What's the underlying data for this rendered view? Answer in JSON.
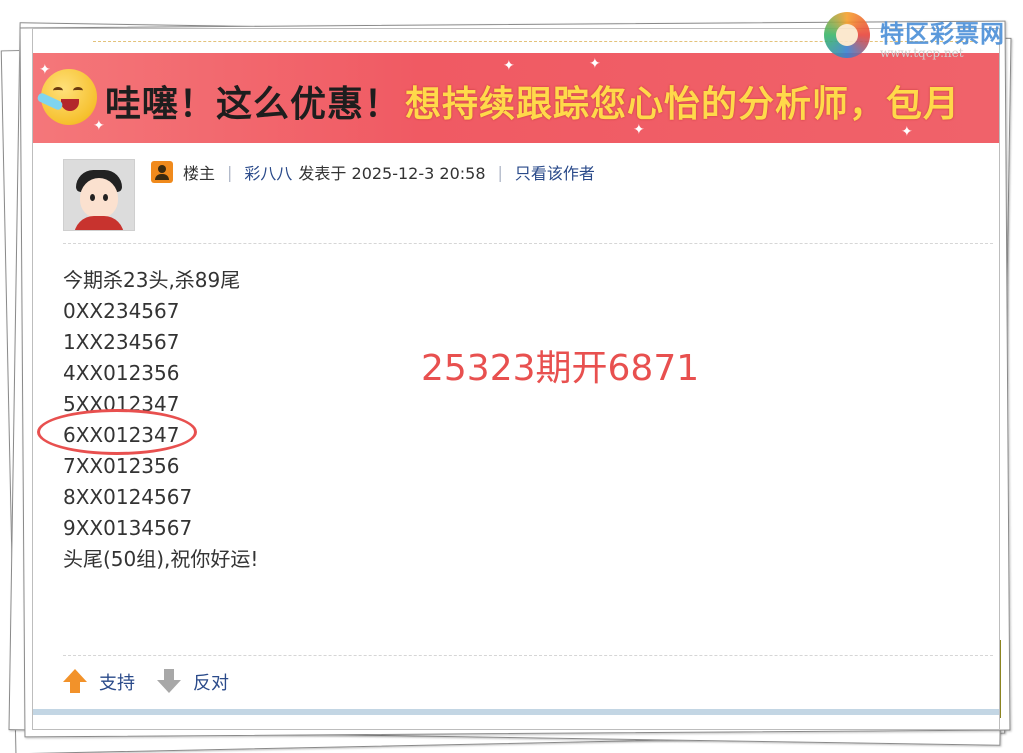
{
  "banner": {
    "left_text": "哇噻！这么优惠！",
    "right_text": "想持续跟踪您心怡的分析师，包月"
  },
  "logo": {
    "name": "特区彩票网",
    "url": "www.tqcp.net"
  },
  "post": {
    "role": "楼主",
    "author": "彩八八",
    "posted_at": "发表于 2025-12-3 20:58",
    "only_author": "只看该作者"
  },
  "content": {
    "lines": [
      "今期杀23头,杀89尾",
      "0XX234567",
      "1XX234567",
      "4XX012356",
      "5XX012347",
      "6XX012347",
      "7XX012356",
      "8XX0124567",
      "9XX0134567",
      "头尾(50组),祝你好运!"
    ],
    "result": "25323期开6871"
  },
  "actions": {
    "support": "支持",
    "oppose": "反对"
  },
  "colors": {
    "banner_bg": "#f05a63",
    "link": "#2a4a8a",
    "highlight": "#e8504f",
    "owner_badge": "#f08a1c"
  }
}
